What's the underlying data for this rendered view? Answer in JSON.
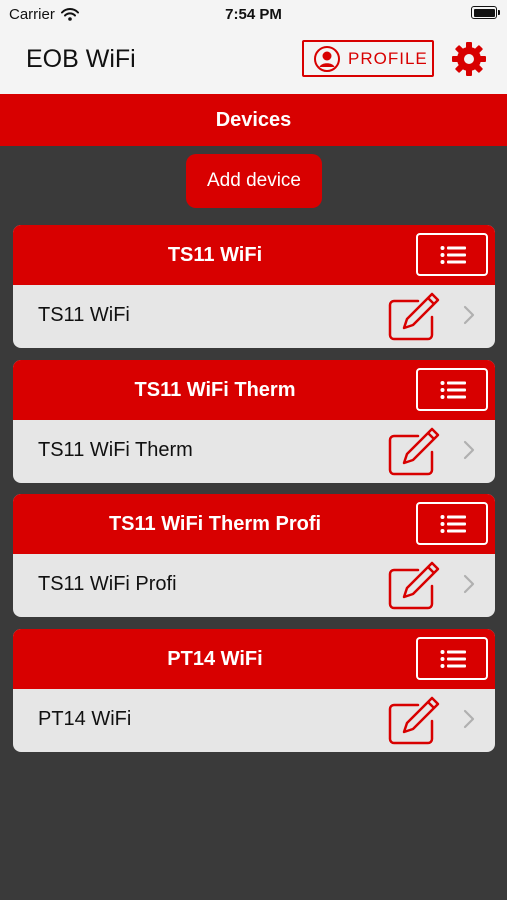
{
  "status_bar": {
    "carrier": "Carrier",
    "time": "7:54 PM"
  },
  "nav": {
    "title": "EOB WiFi",
    "profile_label": "PROFILE"
  },
  "section": {
    "title": "Devices"
  },
  "add_device_label": "Add device",
  "colors": {
    "accent": "#d80000",
    "background": "#3a3a3a",
    "row": "#e6e6e6",
    "nav": "#f4f4f4"
  },
  "devices": [
    {
      "group": "TS11 WiFi",
      "name": "TS11 WiFi"
    },
    {
      "group": "TS11 WiFi Therm",
      "name": "TS11 WiFi Therm"
    },
    {
      "group": "TS11 WiFi Therm Profi",
      "name": "TS11 WiFi Profi"
    },
    {
      "group": "PT14 WiFi",
      "name": "PT14 WiFi"
    }
  ],
  "icons": {
    "wifi": "wifi-icon",
    "battery": "battery-icon",
    "profile": "person-icon",
    "settings": "gear-icon",
    "list": "list-icon",
    "edit": "edit-icon",
    "chevron": "chevron-right-icon"
  }
}
